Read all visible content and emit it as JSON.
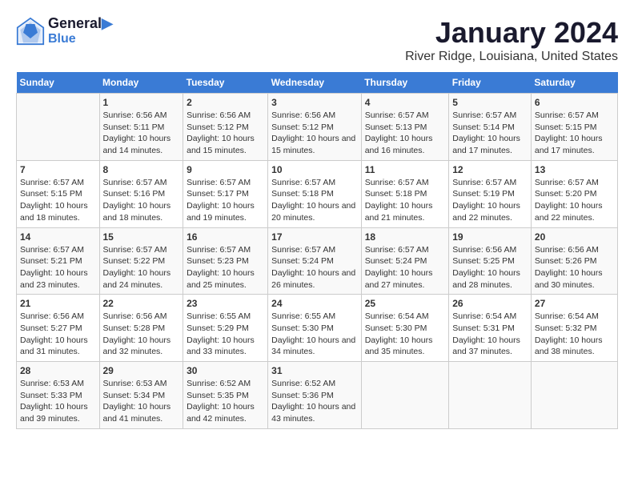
{
  "logo": {
    "line1": "General",
    "line2": "Blue"
  },
  "title": "January 2024",
  "subtitle": "River Ridge, Louisiana, United States",
  "days_header": [
    "Sunday",
    "Monday",
    "Tuesday",
    "Wednesday",
    "Thursday",
    "Friday",
    "Saturday"
  ],
  "weeks": [
    [
      {
        "day": "",
        "sunrise": "",
        "sunset": "",
        "daylight": ""
      },
      {
        "day": "1",
        "sunrise": "Sunrise: 6:56 AM",
        "sunset": "Sunset: 5:11 PM",
        "daylight": "Daylight: 10 hours and 14 minutes."
      },
      {
        "day": "2",
        "sunrise": "Sunrise: 6:56 AM",
        "sunset": "Sunset: 5:12 PM",
        "daylight": "Daylight: 10 hours and 15 minutes."
      },
      {
        "day": "3",
        "sunrise": "Sunrise: 6:56 AM",
        "sunset": "Sunset: 5:12 PM",
        "daylight": "Daylight: 10 hours and 15 minutes."
      },
      {
        "day": "4",
        "sunrise": "Sunrise: 6:57 AM",
        "sunset": "Sunset: 5:13 PM",
        "daylight": "Daylight: 10 hours and 16 minutes."
      },
      {
        "day": "5",
        "sunrise": "Sunrise: 6:57 AM",
        "sunset": "Sunset: 5:14 PM",
        "daylight": "Daylight: 10 hours and 17 minutes."
      },
      {
        "day": "6",
        "sunrise": "Sunrise: 6:57 AM",
        "sunset": "Sunset: 5:15 PM",
        "daylight": "Daylight: 10 hours and 17 minutes."
      }
    ],
    [
      {
        "day": "7",
        "sunrise": "Sunrise: 6:57 AM",
        "sunset": "Sunset: 5:15 PM",
        "daylight": "Daylight: 10 hours and 18 minutes."
      },
      {
        "day": "8",
        "sunrise": "Sunrise: 6:57 AM",
        "sunset": "Sunset: 5:16 PM",
        "daylight": "Daylight: 10 hours and 18 minutes."
      },
      {
        "day": "9",
        "sunrise": "Sunrise: 6:57 AM",
        "sunset": "Sunset: 5:17 PM",
        "daylight": "Daylight: 10 hours and 19 minutes."
      },
      {
        "day": "10",
        "sunrise": "Sunrise: 6:57 AM",
        "sunset": "Sunset: 5:18 PM",
        "daylight": "Daylight: 10 hours and 20 minutes."
      },
      {
        "day": "11",
        "sunrise": "Sunrise: 6:57 AM",
        "sunset": "Sunset: 5:18 PM",
        "daylight": "Daylight: 10 hours and 21 minutes."
      },
      {
        "day": "12",
        "sunrise": "Sunrise: 6:57 AM",
        "sunset": "Sunset: 5:19 PM",
        "daylight": "Daylight: 10 hours and 22 minutes."
      },
      {
        "day": "13",
        "sunrise": "Sunrise: 6:57 AM",
        "sunset": "Sunset: 5:20 PM",
        "daylight": "Daylight: 10 hours and 22 minutes."
      }
    ],
    [
      {
        "day": "14",
        "sunrise": "Sunrise: 6:57 AM",
        "sunset": "Sunset: 5:21 PM",
        "daylight": "Daylight: 10 hours and 23 minutes."
      },
      {
        "day": "15",
        "sunrise": "Sunrise: 6:57 AM",
        "sunset": "Sunset: 5:22 PM",
        "daylight": "Daylight: 10 hours and 24 minutes."
      },
      {
        "day": "16",
        "sunrise": "Sunrise: 6:57 AM",
        "sunset": "Sunset: 5:23 PM",
        "daylight": "Daylight: 10 hours and 25 minutes."
      },
      {
        "day": "17",
        "sunrise": "Sunrise: 6:57 AM",
        "sunset": "Sunset: 5:24 PM",
        "daylight": "Daylight: 10 hours and 26 minutes."
      },
      {
        "day": "18",
        "sunrise": "Sunrise: 6:57 AM",
        "sunset": "Sunset: 5:24 PM",
        "daylight": "Daylight: 10 hours and 27 minutes."
      },
      {
        "day": "19",
        "sunrise": "Sunrise: 6:56 AM",
        "sunset": "Sunset: 5:25 PM",
        "daylight": "Daylight: 10 hours and 28 minutes."
      },
      {
        "day": "20",
        "sunrise": "Sunrise: 6:56 AM",
        "sunset": "Sunset: 5:26 PM",
        "daylight": "Daylight: 10 hours and 30 minutes."
      }
    ],
    [
      {
        "day": "21",
        "sunrise": "Sunrise: 6:56 AM",
        "sunset": "Sunset: 5:27 PM",
        "daylight": "Daylight: 10 hours and 31 minutes."
      },
      {
        "day": "22",
        "sunrise": "Sunrise: 6:56 AM",
        "sunset": "Sunset: 5:28 PM",
        "daylight": "Daylight: 10 hours and 32 minutes."
      },
      {
        "day": "23",
        "sunrise": "Sunrise: 6:55 AM",
        "sunset": "Sunset: 5:29 PM",
        "daylight": "Daylight: 10 hours and 33 minutes."
      },
      {
        "day": "24",
        "sunrise": "Sunrise: 6:55 AM",
        "sunset": "Sunset: 5:30 PM",
        "daylight": "Daylight: 10 hours and 34 minutes."
      },
      {
        "day": "25",
        "sunrise": "Sunrise: 6:54 AM",
        "sunset": "Sunset: 5:30 PM",
        "daylight": "Daylight: 10 hours and 35 minutes."
      },
      {
        "day": "26",
        "sunrise": "Sunrise: 6:54 AM",
        "sunset": "Sunset: 5:31 PM",
        "daylight": "Daylight: 10 hours and 37 minutes."
      },
      {
        "day": "27",
        "sunrise": "Sunrise: 6:54 AM",
        "sunset": "Sunset: 5:32 PM",
        "daylight": "Daylight: 10 hours and 38 minutes."
      }
    ],
    [
      {
        "day": "28",
        "sunrise": "Sunrise: 6:53 AM",
        "sunset": "Sunset: 5:33 PM",
        "daylight": "Daylight: 10 hours and 39 minutes."
      },
      {
        "day": "29",
        "sunrise": "Sunrise: 6:53 AM",
        "sunset": "Sunset: 5:34 PM",
        "daylight": "Daylight: 10 hours and 41 minutes."
      },
      {
        "day": "30",
        "sunrise": "Sunrise: 6:52 AM",
        "sunset": "Sunset: 5:35 PM",
        "daylight": "Daylight: 10 hours and 42 minutes."
      },
      {
        "day": "31",
        "sunrise": "Sunrise: 6:52 AM",
        "sunset": "Sunset: 5:36 PM",
        "daylight": "Daylight: 10 hours and 43 minutes."
      },
      {
        "day": "",
        "sunrise": "",
        "sunset": "",
        "daylight": ""
      },
      {
        "day": "",
        "sunrise": "",
        "sunset": "",
        "daylight": ""
      },
      {
        "day": "",
        "sunrise": "",
        "sunset": "",
        "daylight": ""
      }
    ]
  ]
}
